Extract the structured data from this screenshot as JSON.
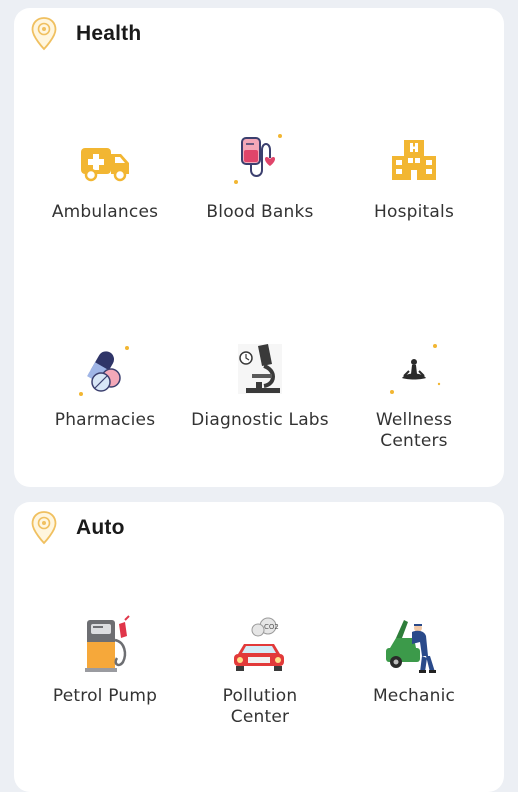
{
  "sections": [
    {
      "title": "Health",
      "icon": "location-pin-icon",
      "items": [
        {
          "label": "Ambulances",
          "icon": "ambulance-icon"
        },
        {
          "label": "Blood Banks",
          "icon": "blood-bag-icon"
        },
        {
          "label": "Hospitals",
          "icon": "hospital-icon"
        },
        {
          "label": "Pharmacies",
          "icon": "pills-icon"
        },
        {
          "label": "Diagnostic Labs",
          "icon": "microscope-icon"
        },
        {
          "label": "Wellness Centers",
          "icon": "meditation-icon"
        }
      ]
    },
    {
      "title": "Auto",
      "icon": "location-pin-icon",
      "items": [
        {
          "label": "Petrol Pump",
          "icon": "fuel-pump-icon"
        },
        {
          "label": "Pollution Center",
          "icon": "car-emission-icon"
        },
        {
          "label": "Mechanic",
          "icon": "mechanic-icon"
        }
      ]
    }
  ],
  "colors": {
    "accent": "#f0b840",
    "background": "#eceff4",
    "card": "#ffffff",
    "text": "#333333"
  }
}
